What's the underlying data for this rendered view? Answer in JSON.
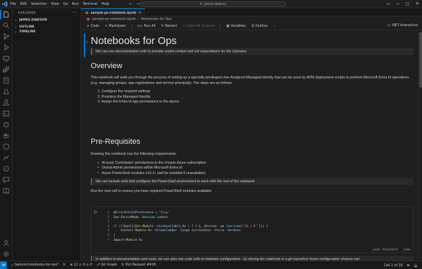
{
  "menu": [
    "File",
    "Edit",
    "Selection",
    "View",
    "Go",
    "Run",
    "Terminal",
    "Help"
  ],
  "search": {
    "text": "james.dawson"
  },
  "sidebar": {
    "title": "EXPLORER",
    "sections": [
      "JAMES.DAWSON",
      "OUTLINE",
      "TIMELINE"
    ]
  },
  "tab": {
    "label": "sample-ps-notebook.ipynb"
  },
  "breadcrumb": {
    "file": "sample-ps-notebook.ipynb",
    "item": "Notebooks for Ops"
  },
  "toolbar": {
    "code": "Code",
    "markdown": "Markdown",
    "run_all": "Run All",
    "restart": "Restart",
    "clear": "Clear All Outputs",
    "variables": "Variables",
    "outline": "Outline",
    "kernel": ".NET Interactive"
  },
  "notebook": {
    "title": "Notebooks for Ops",
    "quote1": "We can use documentation cells to provide useful context and set expectations for the Operator.",
    "h_overview": "Overview",
    "overview_para": "This notebook will walk you through the process of setting-up a specially-privileged User Assigned Managed Identity that can be used by ARM deployment scripts to perform Microsoft Entra Id operations. (e.g. managing groups, app registrations and service principals). The steps are as follows:",
    "steps": [
      "1. Configure the required settings",
      "2. Provision the Managed Identity",
      "3. Assign the Entra Id app permissions to the above"
    ],
    "h_prereq": "Pre-Requisites",
    "prereq_para": "Running this notebook has the following requirements:",
    "requirements": [
      "At least 'Contributor' permissions to the chosen Azure subscription",
      "Global Admin permissions within Microsoft Entra Id",
      "Azure PowerShell modules v10.1+ (will be installed if unavailable)"
    ],
    "quote2": "We can include cells that configure the PowerShell environment to work with the rest of the notebook.",
    "run_para": "Run the next cell to ensure you have required PowerShell modules available.",
    "quote3": "In addition to documentation and code, we can also use code cells to maintain configuration - by storing the notebook in a git repository those configuration choices can"
  },
  "code_cell": {
    "line_numbers": [
      "1",
      "2",
      "3",
      "4",
      "5",
      "6",
      "7"
    ],
    "lang": "pwsh - PowerShell",
    "tag": "Code"
  },
  "status": {
    "branch": "feature/notebooks-for-ops*",
    "sync": "↻",
    "problems": "⊗ 12  ⚠ 0  ⊙ 0",
    "graph": "Git Graph",
    "pr": "Pull Request #418",
    "position": "Cell 1 of 18"
  },
  "colors": {
    "accent": "#0078d4",
    "bg": "#1f1f1f"
  }
}
